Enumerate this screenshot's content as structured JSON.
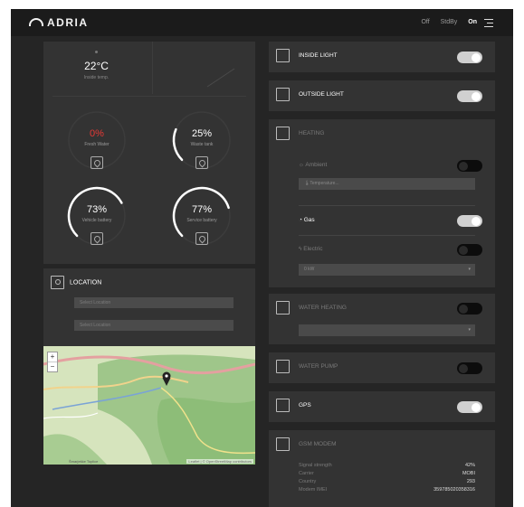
{
  "header": {
    "brand": "ADRIA",
    "modes": [
      "Off",
      "StdBy",
      "On"
    ],
    "active_mode": "On"
  },
  "dashboard": {
    "temperature": {
      "value": "22°C",
      "label": "Inside temp."
    },
    "gauges": [
      {
        "value": "0%",
        "label": "Fresh Water",
        "level": 0,
        "color": "#e53935",
        "icon": "water-drop-icon"
      },
      {
        "value": "25%",
        "label": "Waste tank",
        "level": 0.25,
        "color": "#ffffff",
        "icon": "waste-tank-icon"
      },
      {
        "value": "73%",
        "label": "Vehicle battery",
        "level": 0.73,
        "color": "#ffffff",
        "icon": "vehicle-battery-icon"
      },
      {
        "value": "77%",
        "label": "Service battery",
        "level": 0.77,
        "color": "#ffffff",
        "icon": "service-battery-icon"
      }
    ]
  },
  "location": {
    "title": "LOCATION",
    "input1": "Select Location",
    "input2": "Select Location",
    "map": {
      "attribution": "Leaflet | © OpenStreetMap contributors",
      "scale": "Šmarješke Toplice",
      "zoom_in": "+",
      "zoom_out": "−"
    }
  },
  "controls": {
    "inside_light": {
      "label": "INSIDE LIGHT",
      "state": "on"
    },
    "outside_light": {
      "label": "OUTSIDE LIGHT",
      "state": "on"
    },
    "heating": {
      "label": "HEATING",
      "ambient": {
        "label": "Ambient",
        "state": "off"
      },
      "temperature_placeholder": "Temperature...",
      "gas": {
        "label": "Gas",
        "state": "on"
      },
      "electric": {
        "label": "Electric",
        "state": "off"
      },
      "power": "0 kW"
    },
    "water_heating": {
      "label": "WATER HEATING",
      "state": "off"
    },
    "water_pump": {
      "label": "WATER PUMP",
      "state": "off"
    },
    "gps": {
      "label": "GPS",
      "state": "on"
    },
    "gsm_modem": {
      "label": "GSM MODEM",
      "rows": [
        {
          "key": "Signal strength",
          "value": "42%"
        },
        {
          "key": "Carrier",
          "value": "MOBI"
        },
        {
          "key": "Country",
          "value": "293"
        },
        {
          "key": "Modem IMEI",
          "value": "359785020358316"
        }
      ]
    }
  },
  "colors": {
    "background": "#252525",
    "panel": "#333333",
    "toggle_on": "#d0d0d0",
    "toggle_off": "#0c0c0c",
    "alert": "#e53935"
  }
}
